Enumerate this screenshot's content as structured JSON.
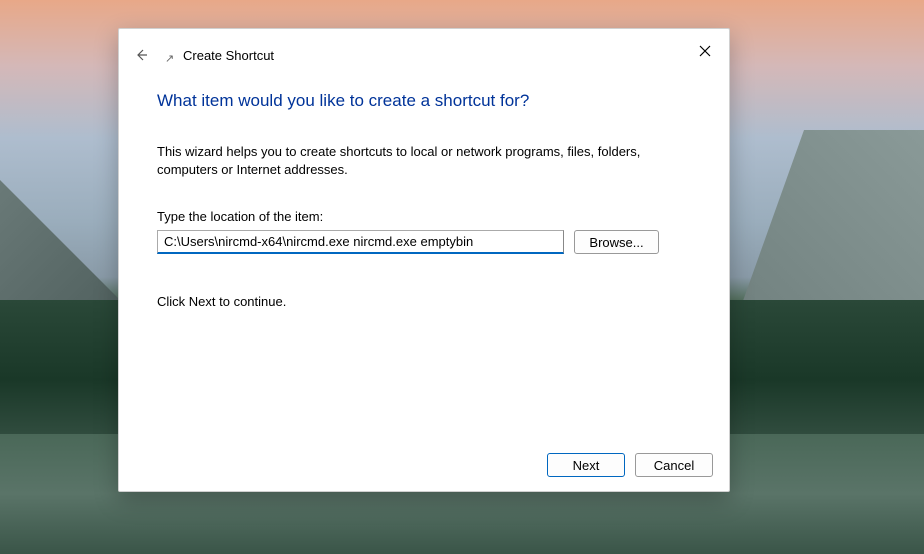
{
  "dialog": {
    "title": "Create Shortcut",
    "heading": "What item would you like to create a shortcut for?",
    "description": "This wizard helps you to create shortcuts to local or network programs, files, folders, computers or Internet addresses.",
    "input_label": "Type the location of the item:",
    "input_value": "C:\\Users\\nircmd-x64\\nircmd.exe nircmd.exe emptybin",
    "browse_label": "Browse...",
    "continue_text": "Click Next to continue.",
    "next_label": "Next",
    "cancel_label": "Cancel"
  }
}
